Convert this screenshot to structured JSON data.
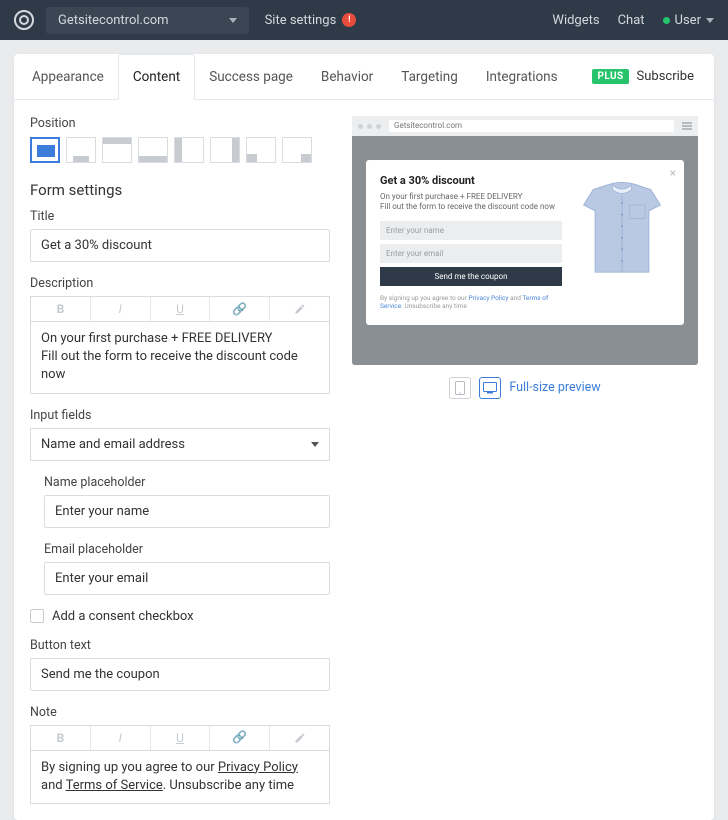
{
  "topbar": {
    "site": "Getsitecontrol.com",
    "settings_label": "Site settings",
    "right": {
      "widgets": "Widgets",
      "chat": "Chat",
      "user": "User"
    }
  },
  "tabs": {
    "items": [
      "Appearance",
      "Content",
      "Success page",
      "Behavior",
      "Targeting",
      "Integrations"
    ],
    "active_index": 1,
    "plus_label": "PLUS",
    "subscribe": "Subscribe"
  },
  "position": {
    "label": "Position"
  },
  "form": {
    "heading": "Form settings",
    "title_label": "Title",
    "title_value": "Get a 30% discount",
    "desc_label": "Description",
    "desc_line1": "On your first purchase + FREE DELIVERY",
    "desc_line2": "Fill out the form to receive the discount code now",
    "input_fields_label": "Input fields",
    "input_fields_value": "Name and email address",
    "name_ph_label": "Name placeholder",
    "name_ph_value": "Enter your name",
    "email_ph_label": "Email placeholder",
    "email_ph_value": "Enter your email",
    "consent_label": "Add a consent checkbox",
    "button_label": "Button text",
    "button_value": "Send me the coupon",
    "note_label": "Note",
    "note_pre": "By signing up you agree to our ",
    "note_pp": "Privacy Policy",
    "note_mid": " and ",
    "note_tos": "Terms of Service",
    "note_post": ". Unsubscribe any time"
  },
  "preview": {
    "address": "Getsitecontrol.com",
    "widget_title": "Get a 30% discount",
    "widget_desc": "On your first purchase + FREE DELIVERY\nFill out the form to receive the discount code now",
    "input_name": "Enter your name",
    "input_email": "Enter your email",
    "button": "Send me the coupon",
    "note_pre": "By signing up you agree to our ",
    "note_pp": "Privacy Policy",
    "note_and": " and ",
    "note_tos": "Terms of Service",
    "note_post": ". Unsubscribe any time",
    "full_link": "Full-size preview"
  }
}
